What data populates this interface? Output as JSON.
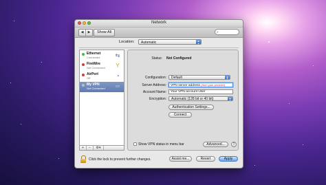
{
  "window": {
    "title": "Network"
  },
  "toolbar": {
    "back_label": "◀",
    "forward_label": "▶",
    "show_all_label": "Show All"
  },
  "location": {
    "label": "Location:",
    "value": "Automatic"
  },
  "sidebar": {
    "items": [
      {
        "name": "Ethernet",
        "status": "Connected",
        "dot_color": "#3fbf3f",
        "icon": "ethernet-icon"
      },
      {
        "name": "FireWire",
        "status": "Not Connected",
        "dot_color": "#d23b3b",
        "icon": "firewire-icon"
      },
      {
        "name": "AirPort",
        "status": "Off",
        "dot_color": "#d23b3b",
        "icon": "wifi-icon"
      },
      {
        "name": "My VPN",
        "status": "Not Connected",
        "dot_color": "#8a8a8a",
        "icon": "vpn-icon"
      }
    ],
    "add_label": "+",
    "remove_label": "−",
    "action_label": "⚙▾"
  },
  "details": {
    "status_label": "Status:",
    "status_value": "Not Configured",
    "configuration_label": "Configuration:",
    "configuration_value": "Default",
    "server_label": "Server Address:",
    "server_value": "VPN server address",
    "server_hint": "(from your provider)",
    "account_label": "Account Name:",
    "account_value": "Your VPN account User",
    "encryption_label": "Encryption:",
    "encryption_value": "Automatic (128 bit or 40 bit)",
    "auth_button": "Authentication Settings...",
    "connect_button": "Connect"
  },
  "footer_pane": {
    "show_vpn_label": "Show VPN status in menu bar",
    "advanced_button": "Advanced...",
    "help_label": "?"
  },
  "bottom": {
    "lock_text": "Click the lock to prevent further changes.",
    "assist_button": "Assist me...",
    "revert_button": "Revert",
    "apply_button": "Apply"
  }
}
